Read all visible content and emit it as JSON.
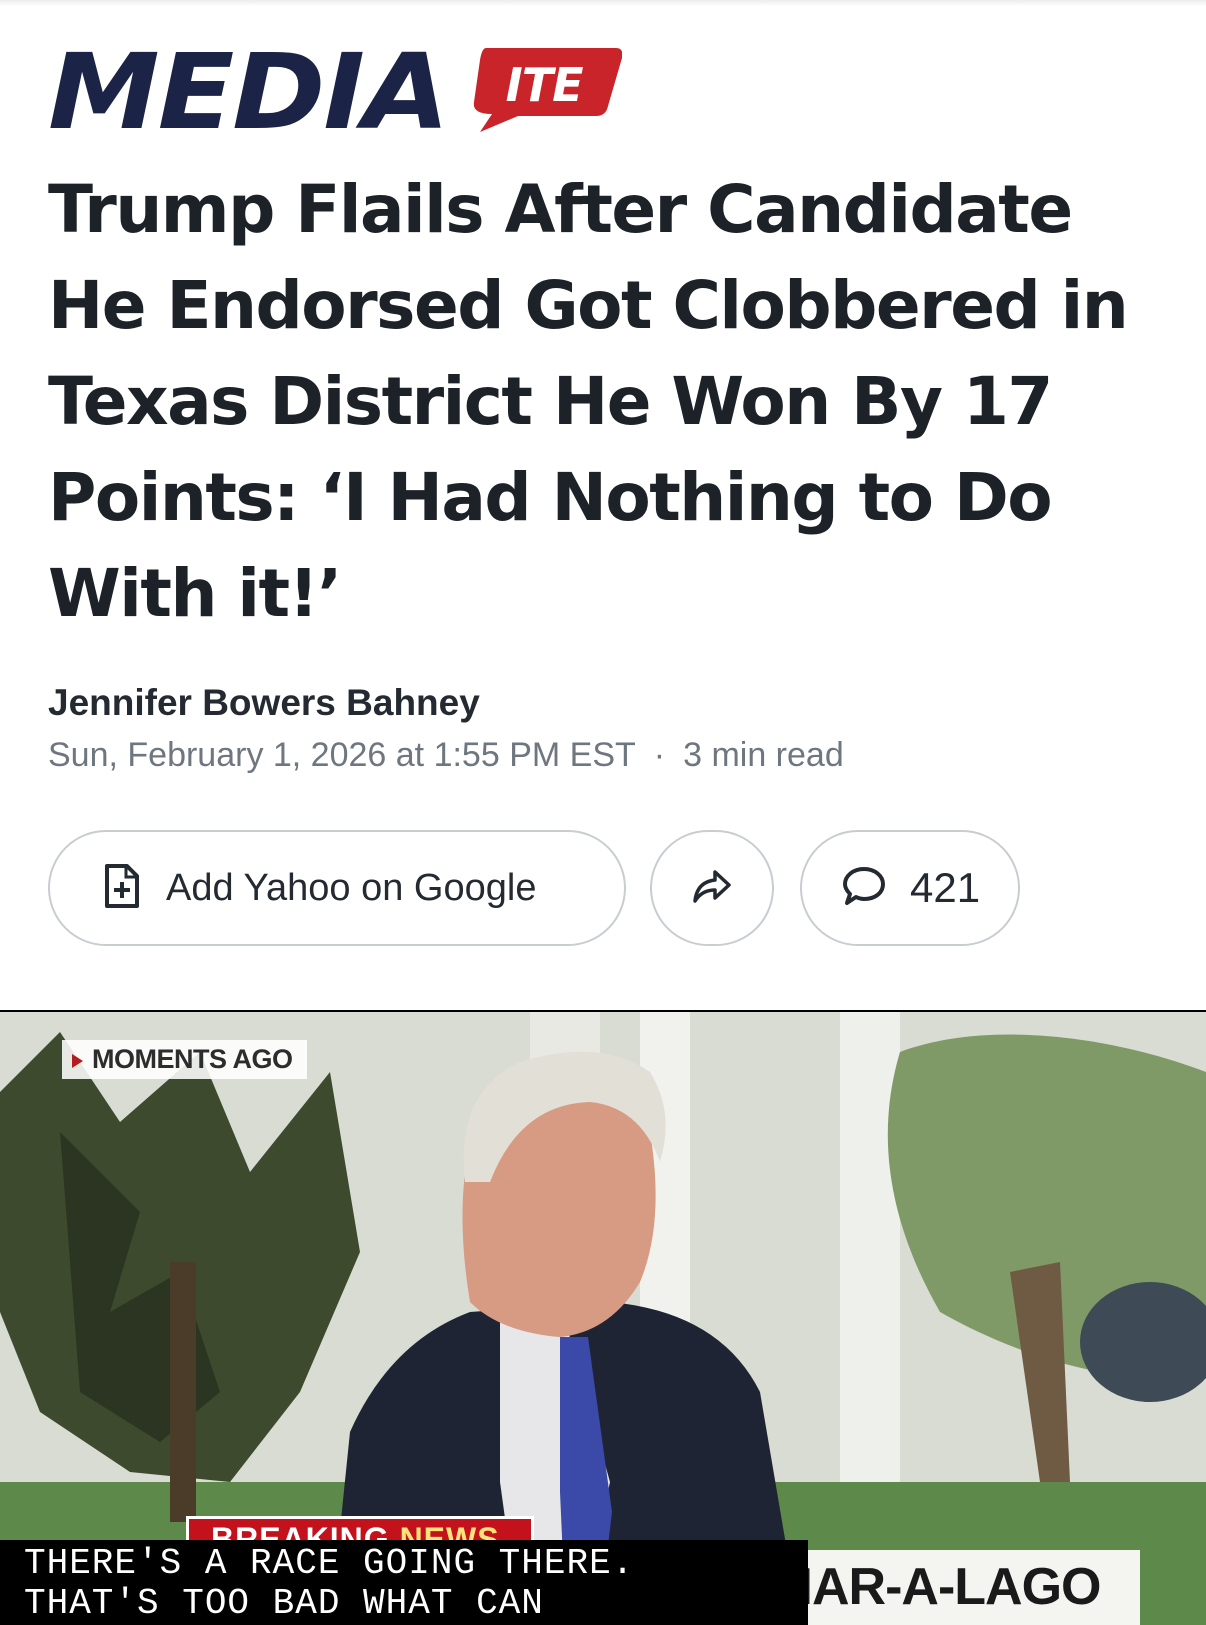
{
  "brand": {
    "logo_main": "MEDIA",
    "logo_badge": "ITE",
    "navy": "#1b2447",
    "red": "#c8242a"
  },
  "article": {
    "headline": "Trump Flails After Candidate He Endorsed Got Clobbered in Texas District He Won By 17 Points: ‘I Had Nothing to Do With it!’",
    "author": "Jennifer Bowers Bahney",
    "date": "Sun, February 1, 2026 at 1:55 PM EST",
    "separator": "·",
    "read_time": "3 min read"
  },
  "actions": {
    "add_label": "Add Yahoo on Google",
    "add_icon": "add-document-icon",
    "share_icon": "share-arrow-icon",
    "comment_icon": "speech-bubble-icon",
    "comment_count": "421"
  },
  "photo": {
    "tag": "MOMENTS AGO",
    "breaking_a": "BREAKING ",
    "breaking_b": "NEWS",
    "lower_third": "S FROM MAR-A-LAGO",
    "caption_line1": "THERE'S A RACE GOING THERE.",
    "caption_line2": "THAT'S TOO BAD WHAT CAN"
  }
}
